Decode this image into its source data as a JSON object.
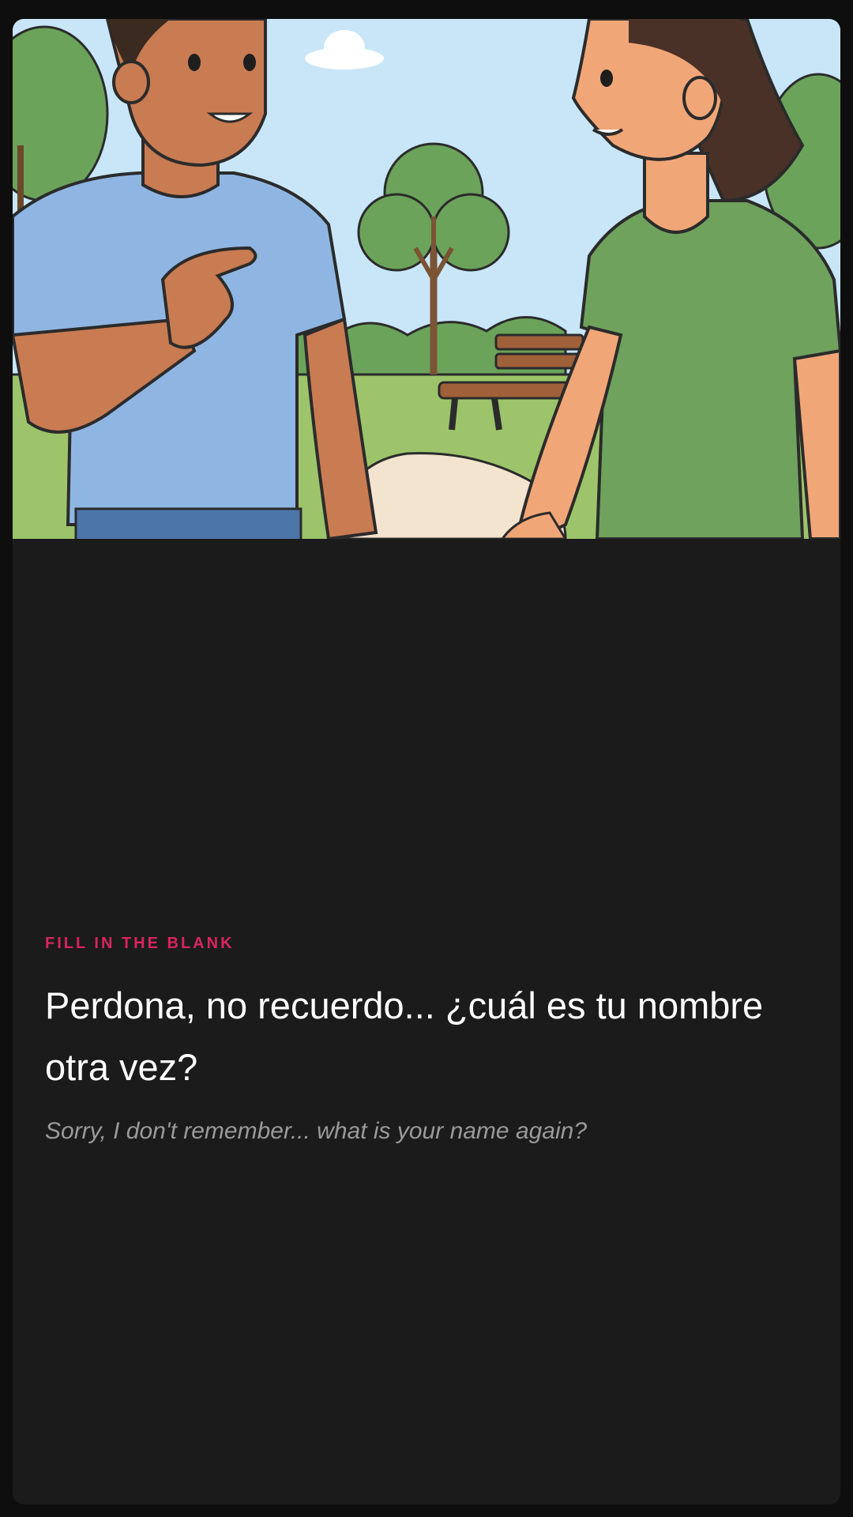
{
  "exercise": {
    "label": "FILL IN THE BLANK",
    "sentence": "Perdona, no recuerdo... ¿cuál es tu nombre otra vez?",
    "translation": "Sorry, I don't remember... what is your name again?"
  },
  "illustration": {
    "colors": {
      "sky": "#c8e6f8",
      "grass": "#9dc46a",
      "tree": "#6ba35a",
      "man_shirt": "#8fb6e3",
      "woman_shirt": "#6fa25d",
      "skin_man": "#c97b52",
      "skin_woman": "#f1a677",
      "bench": "#a0603a",
      "path": "#f3e4cf"
    }
  }
}
